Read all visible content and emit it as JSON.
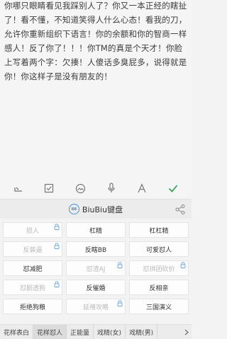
{
  "note": {
    "text": "你哪只眼睛看见我踩别人了？你又一本正经的瞎扯了！看不懂，不知道笑得人什么心态！看我的刀，允许你重新组织下语言！你的余额和你的智商一样感人！反了你了！！！你TM的真是个天才！你脸上写着两个字：欠揍！人傻话多臭屁多，说得就是你！你这样子是没有朋友的！"
  },
  "toolbar": {
    "icons": [
      "undo-icon",
      "checkbox-icon",
      "image-icon",
      "microphone-icon",
      "text-format-icon",
      "checkmark-icon"
    ],
    "accent": "#2e9e4f"
  },
  "keyboard": {
    "title": "BiuBiu键盘",
    "logo_text": "BB",
    "logo_color": "#4a8fd9",
    "cells": [
      {
        "label": "损人",
        "locked": true
      },
      {
        "label": "杠精",
        "locked": false
      },
      {
        "label": "杠杠精",
        "locked": false
      },
      {
        "label": "反装逼",
        "locked": true
      },
      {
        "label": "反瞎BB",
        "locked": false
      },
      {
        "label": "可爱怼人",
        "locked": false
      },
      {
        "label": "怼减肥",
        "locked": false
      },
      {
        "label": "怼渣AJ",
        "locked": true
      },
      {
        "label": "怼拼团砍价",
        "locked": true
      },
      {
        "label": "怼剧透狗",
        "locked": true
      },
      {
        "label": "反催婚",
        "locked": false
      },
      {
        "label": "反相亲",
        "locked": false
      },
      {
        "label": "拒绝狗粮",
        "locked": false
      },
      {
        "label": "延禧攻略",
        "locked": true
      },
      {
        "label": "三国演义",
        "locked": false
      }
    ],
    "tabs": [
      {
        "label": "花样表白",
        "active": false
      },
      {
        "label": "花样怼人",
        "active": true
      },
      {
        "label": "正能量",
        "active": false
      },
      {
        "label": "戏精(女)",
        "active": false
      },
      {
        "label": "戏精(男)",
        "active": false
      }
    ]
  }
}
